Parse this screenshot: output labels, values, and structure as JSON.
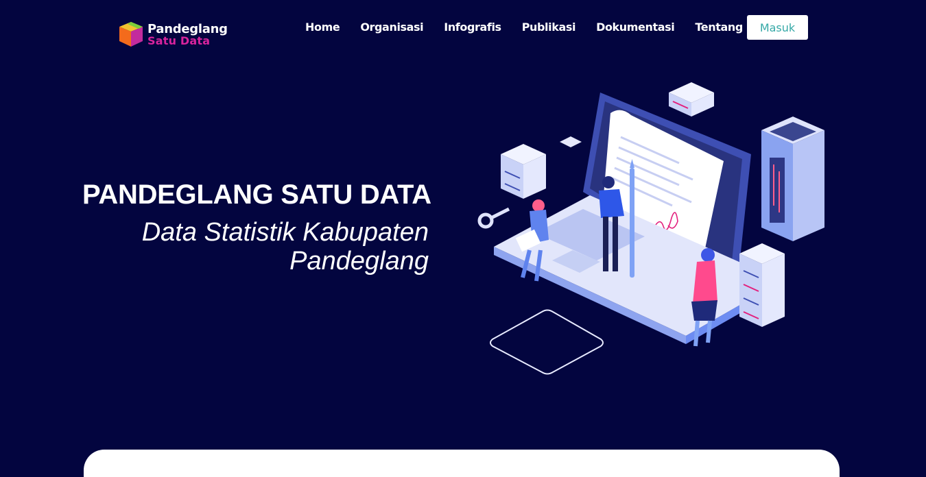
{
  "brand": {
    "name_line1": "Pandeglang",
    "name_line2": "Satu Data",
    "logo_icon": "cube-logo-icon"
  },
  "nav": {
    "items": [
      "Home",
      "Organisasi",
      "Infografis",
      "Publikasi",
      "Dokumentasi",
      "Tentang Kami"
    ],
    "login_label": "Masuk"
  },
  "hero": {
    "title": "PANDEGLANG SATU DATA",
    "subtitle": "Data Statistik Kabupaten Pandeglang",
    "illustration": "laptop-data-illustration"
  },
  "colors": {
    "background": "#03053f",
    "accent_magenta": "#d8239d",
    "button_text": "#36a9a7",
    "illustration_blue": "#6d8cf2"
  }
}
